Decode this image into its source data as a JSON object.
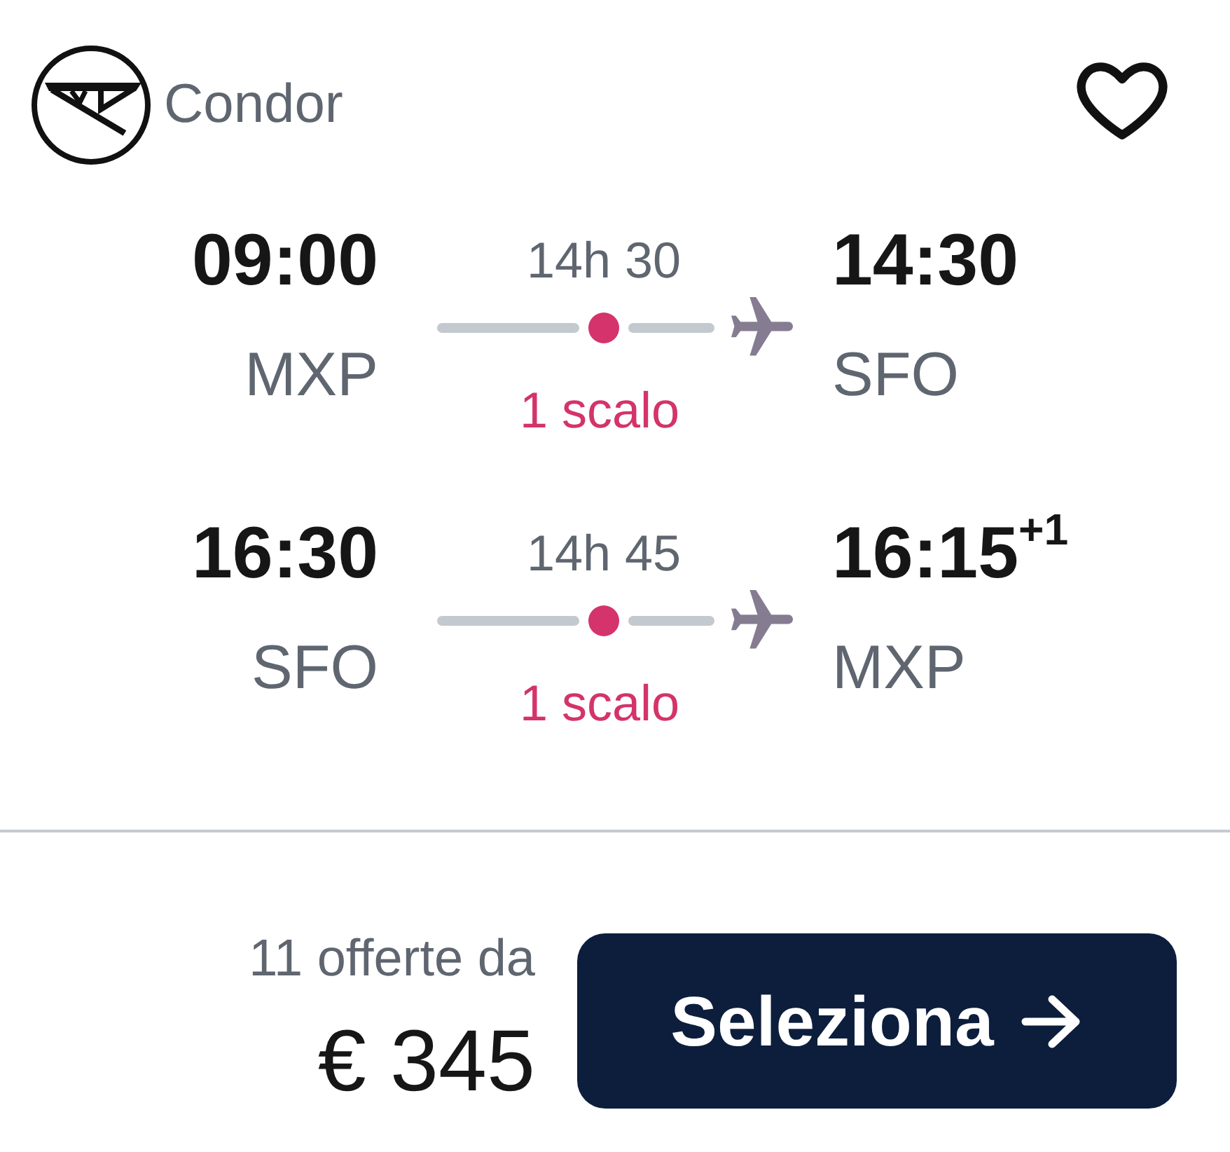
{
  "airline": {
    "name": "Condor"
  },
  "favorite": {
    "saved": false
  },
  "legs": [
    {
      "depart_time": "09:00",
      "depart_airport": "MXP",
      "duration": "14h 30",
      "stops": "1 scalo",
      "arrive_time": "14:30",
      "arrive_airport": "SFO"
    },
    {
      "depart_time": "16:30",
      "depart_airport": "SFO",
      "duration": "14h 45",
      "stops": "1 scalo",
      "arrive_time": "16:15$^{+1}$",
      "arrive_airport": "MXP"
    }
  ],
  "offer": {
    "count_label": "11 offerte da",
    "price": "€ 345",
    "button": "Seleziona"
  }
}
